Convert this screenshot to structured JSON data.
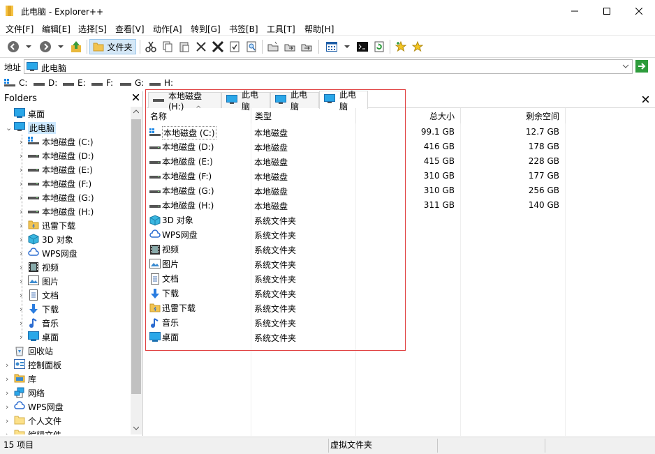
{
  "window": {
    "title": "此电脑 - Explorer++",
    "minimize": "—",
    "maximize": "☐",
    "close": "✕"
  },
  "menu": [
    "文件[F]",
    "编辑[E]",
    "选择[S]",
    "查看[V]",
    "动作[A]",
    "转到[G]",
    "书签[B]",
    "工具[T]",
    "帮助[H]"
  ],
  "toolbar": {
    "folders_label": "文件夹"
  },
  "address": {
    "label": "地址",
    "value": "此电脑"
  },
  "drives": [
    "C:",
    "D:",
    "E:",
    "F:",
    "G:",
    "H:"
  ],
  "folders_pane": {
    "title": "Folders",
    "tree": [
      {
        "label": "桌面",
        "icon": "desktop-icon",
        "expander": ""
      },
      {
        "label": "此电脑",
        "icon": "computer-icon",
        "expander": "⌄",
        "selected": true
      },
      {
        "label": "本地磁盘 (C:)",
        "icon": "system-drive-icon",
        "expander": "›"
      },
      {
        "label": "本地磁盘 (D:)",
        "icon": "drive-icon",
        "expander": "›"
      },
      {
        "label": "本地磁盘 (E:)",
        "icon": "drive-icon",
        "expander": "›"
      },
      {
        "label": "本地磁盘 (F:)",
        "icon": "drive-icon",
        "expander": "›"
      },
      {
        "label": "本地磁盘 (G:)",
        "icon": "drive-icon",
        "expander": "›"
      },
      {
        "label": "本地磁盘 (H:)",
        "icon": "drive-icon",
        "expander": "›"
      },
      {
        "label": "迅雷下载",
        "icon": "thunder-download-icon",
        "expander": "›"
      },
      {
        "label": "3D 对象",
        "icon": "3d-objects-icon",
        "expander": "›"
      },
      {
        "label": "WPS网盘",
        "icon": "wps-cloud-icon",
        "expander": "›"
      },
      {
        "label": "视频",
        "icon": "video-icon",
        "expander": "›"
      },
      {
        "label": "图片",
        "icon": "pictures-icon",
        "expander": "›"
      },
      {
        "label": "文档",
        "icon": "documents-icon",
        "expander": "›"
      },
      {
        "label": "下载",
        "icon": "downloads-icon",
        "expander": "›"
      },
      {
        "label": "音乐",
        "icon": "music-icon",
        "expander": "›"
      },
      {
        "label": "桌面",
        "icon": "desktop-icon",
        "expander": "›"
      },
      {
        "label": "回收站",
        "icon": "recycle-bin-icon",
        "expander": ""
      },
      {
        "label": "控制面板",
        "icon": "control-panel-icon",
        "expander": "›"
      },
      {
        "label": "库",
        "icon": "library-icon",
        "expander": "›"
      },
      {
        "label": "网络",
        "icon": "network-icon",
        "expander": "›"
      },
      {
        "label": "WPS网盘",
        "icon": "wps-cloud-icon",
        "expander": "›"
      },
      {
        "label": "个人文件",
        "icon": "folder-icon",
        "expander": "›"
      },
      {
        "label": "编辑文件",
        "icon": "folder-icon",
        "expander": "›"
      }
    ]
  },
  "tabs": [
    {
      "label": "本地磁盘 (H:)",
      "icon": "drive-icon",
      "active": false
    },
    {
      "label": "此电脑",
      "icon": "computer-icon",
      "active": false
    },
    {
      "label": "此电脑",
      "icon": "computer-icon",
      "active": false
    },
    {
      "label": "此电脑",
      "icon": "computer-icon",
      "active": true
    }
  ],
  "columns": {
    "name": "名称",
    "type": "类型",
    "total": "总大小",
    "free": "剩余空间",
    "sort_indicator": "^"
  },
  "rows": [
    {
      "name": "本地磁盘 (C:)",
      "icon": "system-drive-icon",
      "type": "本地磁盘",
      "total": "99.1 GB",
      "free": "12.7 GB"
    },
    {
      "name": "本地磁盘 (D:)",
      "icon": "drive-icon",
      "type": "本地磁盘",
      "total": "416 GB",
      "free": "178 GB"
    },
    {
      "name": "本地磁盘 (E:)",
      "icon": "drive-icon",
      "type": "本地磁盘",
      "total": "415 GB",
      "free": "228 GB"
    },
    {
      "name": "本地磁盘 (F:)",
      "icon": "drive-icon",
      "type": "本地磁盘",
      "total": "310 GB",
      "free": "177 GB"
    },
    {
      "name": "本地磁盘 (G:)",
      "icon": "drive-icon",
      "type": "本地磁盘",
      "total": "310 GB",
      "free": "256 GB"
    },
    {
      "name": "本地磁盘 (H:)",
      "icon": "drive-icon",
      "type": "本地磁盘",
      "total": "311 GB",
      "free": "140 GB"
    },
    {
      "name": "3D 对象",
      "icon": "3d-objects-icon",
      "type": "系统文件夹",
      "total": "",
      "free": ""
    },
    {
      "name": "WPS网盘",
      "icon": "wps-cloud-icon",
      "type": "系统文件夹",
      "total": "",
      "free": ""
    },
    {
      "name": "视频",
      "icon": "video-icon",
      "type": "系统文件夹",
      "total": "",
      "free": ""
    },
    {
      "name": "图片",
      "icon": "pictures-icon",
      "type": "系统文件夹",
      "total": "",
      "free": ""
    },
    {
      "name": "文档",
      "icon": "documents-icon",
      "type": "系统文件夹",
      "total": "",
      "free": ""
    },
    {
      "name": "下载",
      "icon": "downloads-icon",
      "type": "系统文件夹",
      "total": "",
      "free": ""
    },
    {
      "name": "迅雷下载",
      "icon": "thunder-download-icon",
      "type": "系统文件夹",
      "total": "",
      "free": ""
    },
    {
      "name": "音乐",
      "icon": "music-icon",
      "type": "系统文件夹",
      "total": "",
      "free": ""
    },
    {
      "name": "桌面",
      "icon": "desktop-icon",
      "type": "系统文件夹",
      "total": "",
      "free": ""
    }
  ],
  "status": {
    "count": "15 项目",
    "info": "虚拟文件夹"
  }
}
